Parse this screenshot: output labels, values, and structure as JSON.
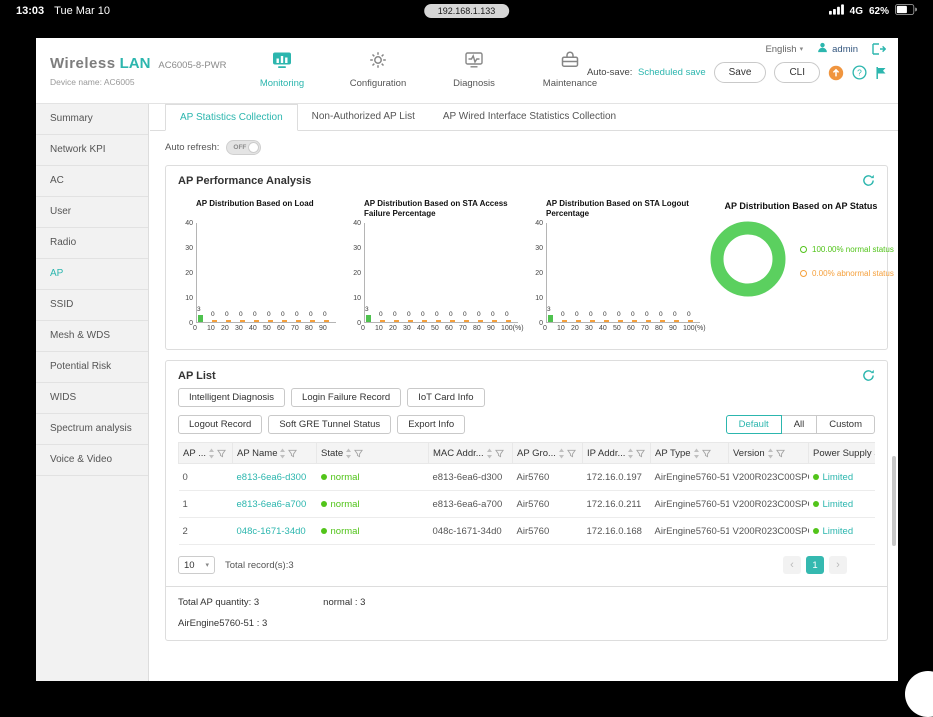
{
  "colors": {
    "accent": "#2cb6ae",
    "green": "#52c41a",
    "orange": "#f5a03c"
  },
  "status_bar": {
    "time": "13:03",
    "date": "Tue Mar 10",
    "address": "192.168.1.133",
    "network": "4G",
    "battery": "62%"
  },
  "header": {
    "logo_primary": "Wireless",
    "logo_secondary": "LAN",
    "model": "AC6005-8-PWR",
    "device_label": "Device name:",
    "device_name": "AC6005",
    "nav_items": [
      {
        "label": "Monitoring",
        "icon": "monitor-chart",
        "active": true
      },
      {
        "label": "Configuration",
        "icon": "gear",
        "active": false
      },
      {
        "label": "Diagnosis",
        "icon": "diagnosis",
        "active": false
      },
      {
        "label": "Maintenance",
        "icon": "maintenance",
        "active": false
      }
    ],
    "autosave_label": "Auto-save:",
    "autosave_value": "Scheduled save",
    "save_button": "Save",
    "cli_button": "CLI",
    "language": "English",
    "user": "admin"
  },
  "sidebar": {
    "items": [
      {
        "label": "Summary",
        "active": false
      },
      {
        "label": "Network KPI",
        "active": false
      },
      {
        "label": "AC",
        "active": false
      },
      {
        "label": "User",
        "active": false
      },
      {
        "label": "Radio",
        "active": false
      },
      {
        "label": "AP",
        "active": true
      },
      {
        "label": "SSID",
        "active": false
      },
      {
        "label": "Mesh & WDS",
        "active": false
      },
      {
        "label": "Potential Risk",
        "active": false
      },
      {
        "label": "WIDS",
        "active": false
      },
      {
        "label": "Spectrum analysis",
        "active": false
      },
      {
        "label": "Voice & Video",
        "active": false
      }
    ]
  },
  "tabs": [
    {
      "label": "AP Statistics Collection",
      "active": true
    },
    {
      "label": "Non-Authorized AP List",
      "active": false
    },
    {
      "label": "AP Wired Interface Statistics Collection",
      "active": false
    }
  ],
  "auto_refresh": {
    "label": "Auto refresh:",
    "state": "OFF"
  },
  "performance": {
    "title": "AP Performance Analysis"
  },
  "chart_data": [
    {
      "type": "bar",
      "title": "AP Distribution Based on Load",
      "title_lines": [
        "AP Distribution Based on Load"
      ],
      "categories": [
        "0",
        "10",
        "20",
        "30",
        "40",
        "50",
        "60",
        "70",
        "80",
        "90"
      ],
      "values": [
        3,
        0,
        0,
        0,
        0,
        0,
        0,
        0,
        0,
        0
      ],
      "y_ticks": [
        "40",
        "30",
        "20",
        "10",
        "0"
      ],
      "ylim": [
        0,
        40
      ],
      "xlabel": "",
      "ylabel": ""
    },
    {
      "type": "bar",
      "title": "AP Distribution Based on STA Access Failure Percentage",
      "title_lines": [
        "AP Distribution Based on STA Access",
        "Failure Percentage"
      ],
      "categories": [
        "0",
        "10",
        "20",
        "30",
        "40",
        "50",
        "60",
        "70",
        "80",
        "90",
        "100(%)"
      ],
      "values": [
        3,
        0,
        0,
        0,
        0,
        0,
        0,
        0,
        0,
        0,
        0
      ],
      "y_ticks": [
        "40",
        "30",
        "20",
        "10",
        "0"
      ],
      "ylim": [
        0,
        40
      ],
      "xlabel": "",
      "ylabel": ""
    },
    {
      "type": "bar",
      "title": "AP Distribution Based on STA Logout Percentage",
      "title_lines": [
        "AP Distribution Based on STA Logout",
        "Percentage"
      ],
      "categories": [
        "0",
        "10",
        "20",
        "30",
        "40",
        "50",
        "60",
        "70",
        "80",
        "90",
        "100(%)"
      ],
      "values": [
        3,
        0,
        0,
        0,
        0,
        0,
        0,
        0,
        0,
        0,
        0
      ],
      "y_ticks": [
        "40",
        "30",
        "20",
        "10",
        "0"
      ],
      "ylim": [
        0,
        40
      ],
      "xlabel": "",
      "ylabel": ""
    },
    {
      "type": "pie",
      "title": "AP Distribution Based on AP Status",
      "slices": [
        {
          "label": "normal status",
          "pct": 100.0,
          "display": "100.00%",
          "color": "#52c41a",
          "ring_color": "#5bd05f"
        },
        {
          "label": "abnormal status",
          "pct": 0.0,
          "display": "0.00%",
          "color": "#f5a03c",
          "ring_color": "#f5a03c"
        }
      ]
    }
  ],
  "ap_list": {
    "title": "AP List",
    "action_buttons_row1": [
      "Intelligent Diagnosis",
      "Login Failure Record",
      "IoT Card Info"
    ],
    "action_buttons_row2": [
      "Logout Record",
      "Soft GRE Tunnel Status",
      "Export Info"
    ],
    "view_buttons": [
      {
        "label": "Default",
        "active": true
      },
      {
        "label": "All",
        "active": false
      },
      {
        "label": "Custom",
        "active": false
      }
    ],
    "columns": [
      "AP ...",
      "AP Name",
      "State",
      "MAC Addr...",
      "AP Gro...",
      "IP Addr...",
      "AP Type",
      "Version",
      "Power Supply Status"
    ],
    "rows": [
      {
        "id": "0",
        "name": "e813-6ea6-d300",
        "state": "normal",
        "mac": "e813-6ea6-d300",
        "group": "Air5760",
        "ip": "172.16.0.197",
        "type": "AirEngine5760-51...",
        "version": "V200R023C00SPC...",
        "power": "Limited"
      },
      {
        "id": "1",
        "name": "e813-6ea6-a700",
        "state": "normal",
        "mac": "e813-6ea6-a700",
        "group": "Air5760",
        "ip": "172.16.0.211",
        "type": "AirEngine5760-51...",
        "version": "V200R023C00SPC...",
        "power": "Limited"
      },
      {
        "id": "2",
        "name": "048c-1671-34d0",
        "state": "normal",
        "mac": "048c-1671-34d0",
        "group": "Air5760",
        "ip": "172.16.0.168",
        "type": "AirEngine5760-51...",
        "version": "V200R023C00SPC...",
        "power": "Limited"
      }
    ],
    "page_size": "10",
    "total_text": "Total record(s):3",
    "current_page": "1",
    "summary": {
      "total": "Total AP quantity: 3",
      "normal": "normal : 3",
      "model_count": "AirEngine5760-51 : 3"
    }
  }
}
